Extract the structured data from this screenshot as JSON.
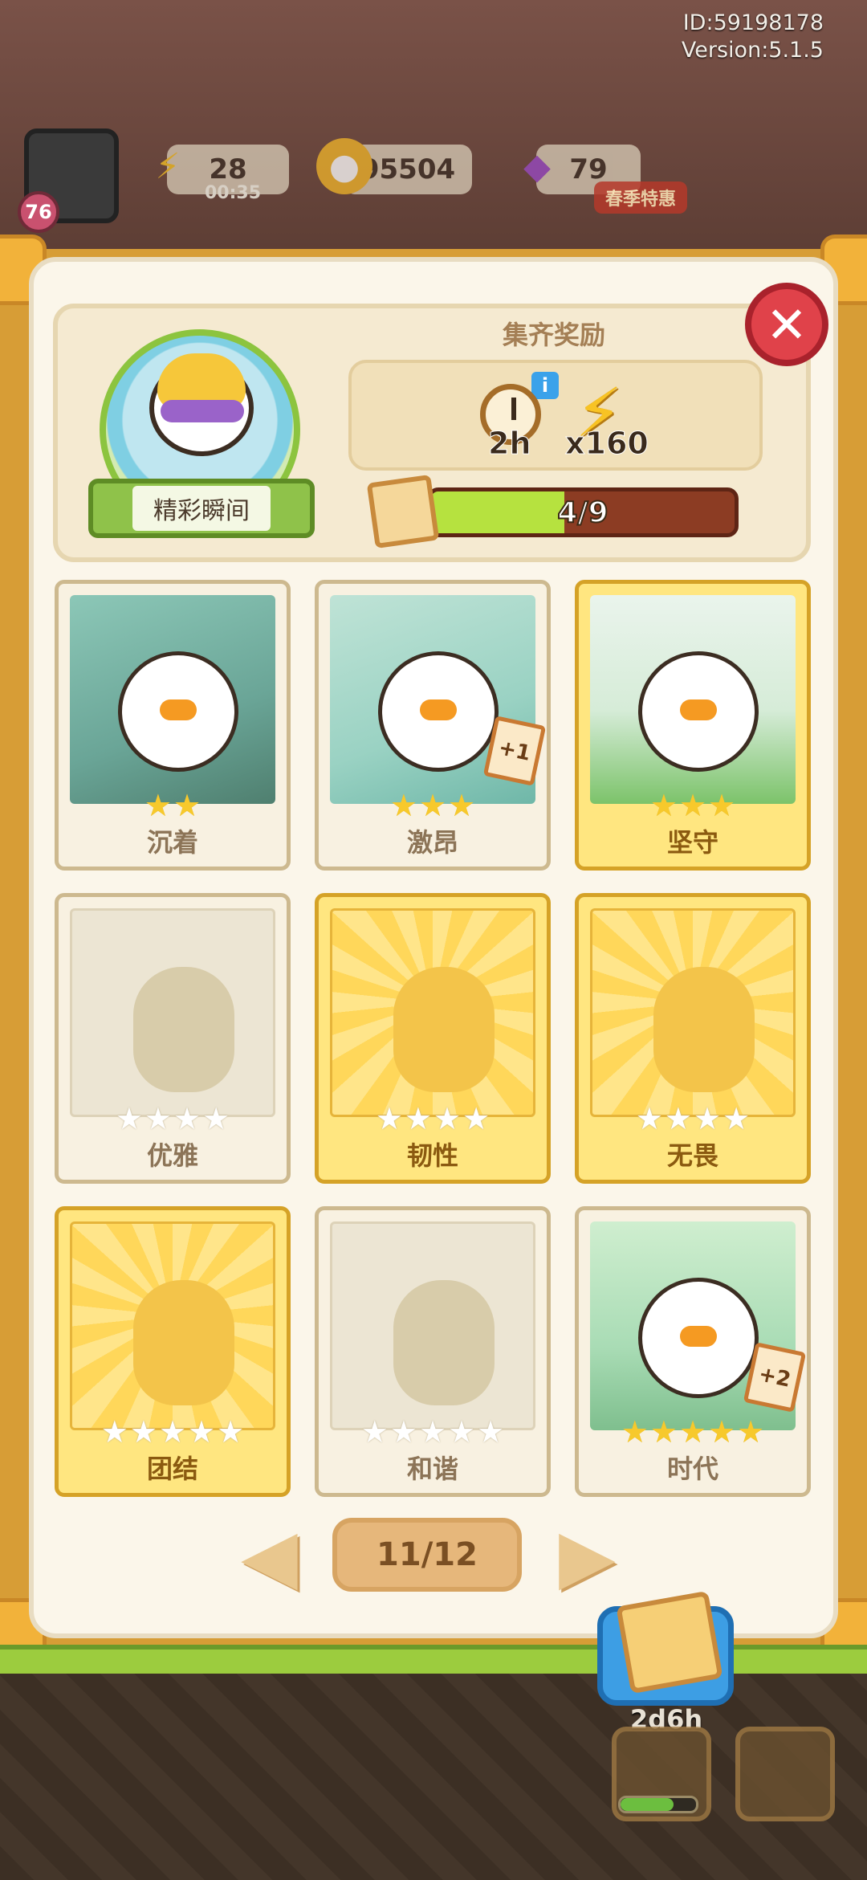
{
  "status": {
    "id": "ID:59198178",
    "version": "Version:5.1.5"
  },
  "hud": {
    "level": "76",
    "energy": "28",
    "energy_timer": "00:35",
    "coins": "95504",
    "gems": "79",
    "event_label": "春季特惠"
  },
  "header": {
    "album_name": "精彩瞬间",
    "reward_title": "集齐奖励",
    "reward_time": "2h",
    "reward_energy": "x160",
    "progress_text": "4/9",
    "progress_fraction": 0.44
  },
  "cards": [
    {
      "name": "沉着",
      "stars": 2,
      "owned": true,
      "gold": false,
      "bonus": "",
      "art": "sniper"
    },
    {
      "name": "激昂",
      "stars": 3,
      "owned": true,
      "gold": false,
      "bonus": "+1",
      "art": "volleyball"
    },
    {
      "name": "坚守",
      "stars": 3,
      "owned": true,
      "gold": true,
      "bonus": "",
      "art": "soccer"
    },
    {
      "name": "优雅",
      "stars": 4,
      "owned": false,
      "gold": false,
      "bonus": "",
      "art": "locked"
    },
    {
      "name": "韧性",
      "stars": 4,
      "owned": false,
      "gold": true,
      "bonus": "",
      "art": "locked"
    },
    {
      "name": "无畏",
      "stars": 4,
      "owned": false,
      "gold": true,
      "bonus": "",
      "art": "locked"
    },
    {
      "name": "团结",
      "stars": 5,
      "owned": false,
      "gold": true,
      "bonus": "",
      "art": "locked"
    },
    {
      "name": "和谐",
      "stars": 5,
      "owned": false,
      "gold": false,
      "bonus": "",
      "art": "locked"
    },
    {
      "name": "时代",
      "stars": 5,
      "owned": true,
      "gold": false,
      "bonus": "+2",
      "art": "podium"
    }
  ],
  "pagination": {
    "page": "11/12"
  },
  "pack": {
    "timer": "2d6h"
  },
  "icons": {
    "close": "close-icon",
    "prev": "arrow-left-icon",
    "next": "arrow-right-icon",
    "clock": "clock-icon",
    "energy": "lightning-icon",
    "info": "info-icon",
    "card": "card-icon",
    "coin": "coin-icon",
    "gem": "gem-icon"
  },
  "colors": {
    "accent_red": "#e0424a",
    "progress_green": "#b6e23f",
    "gold_card": "#ffe680",
    "panel": "#fbf6ea"
  }
}
